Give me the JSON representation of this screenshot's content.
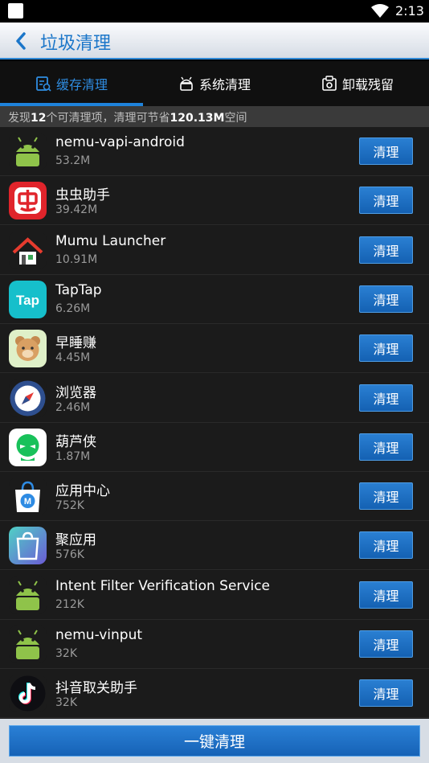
{
  "status_bar": {
    "time": "2:13"
  },
  "header": {
    "back_icon": "chevron-left-icon",
    "title": "垃圾清理"
  },
  "tabs": [
    {
      "label": "缓存清理",
      "icon": "cache-clean-icon",
      "active": true
    },
    {
      "label": "系统清理",
      "icon": "android-robot-icon",
      "active": false
    },
    {
      "label": "卸载残留",
      "icon": "uninstall-residue-icon",
      "active": false
    }
  ],
  "summary": {
    "prefix": "发现",
    "count": "12",
    "middle": "个可清理项，清理可节省",
    "size": "120.13M",
    "suffix": "空间"
  },
  "apps": [
    {
      "name": "nemu-vapi-android",
      "size": "53.2M",
      "icon": "android-icon",
      "button": "清理"
    },
    {
      "name": "虫虫助手",
      "size": "39.42M",
      "icon": "chongchong-icon",
      "button": "清理"
    },
    {
      "name": "Mumu Launcher",
      "size": "10.91M",
      "icon": "mumu-launcher-icon",
      "button": "清理"
    },
    {
      "name": "TapTap",
      "size": "6.26M",
      "icon": "taptap-icon",
      "button": "清理"
    },
    {
      "name": "早睡赚",
      "size": "4.45M",
      "icon": "bear-icon",
      "button": "清理"
    },
    {
      "name": "浏览器",
      "size": "2.46M",
      "icon": "compass-icon",
      "button": "清理"
    },
    {
      "name": "葫芦侠",
      "size": "1.87M",
      "icon": "huluxia-icon",
      "button": "清理"
    },
    {
      "name": "应用中心",
      "size": "752K",
      "icon": "app-center-bag-icon",
      "button": "清理"
    },
    {
      "name": "聚应用",
      "size": "576K",
      "icon": "ju-app-icon",
      "button": "清理"
    },
    {
      "name": "Intent Filter Verification Service",
      "size": "212K",
      "icon": "android-icon",
      "button": "清理"
    },
    {
      "name": "nemu-vinput",
      "size": "32K",
      "icon": "android-icon",
      "button": "清理"
    },
    {
      "name": "抖音取关助手",
      "size": "32K",
      "icon": "tiktok-icon",
      "button": "清理"
    }
  ],
  "footer": {
    "onekey_label": "一键清理"
  }
}
